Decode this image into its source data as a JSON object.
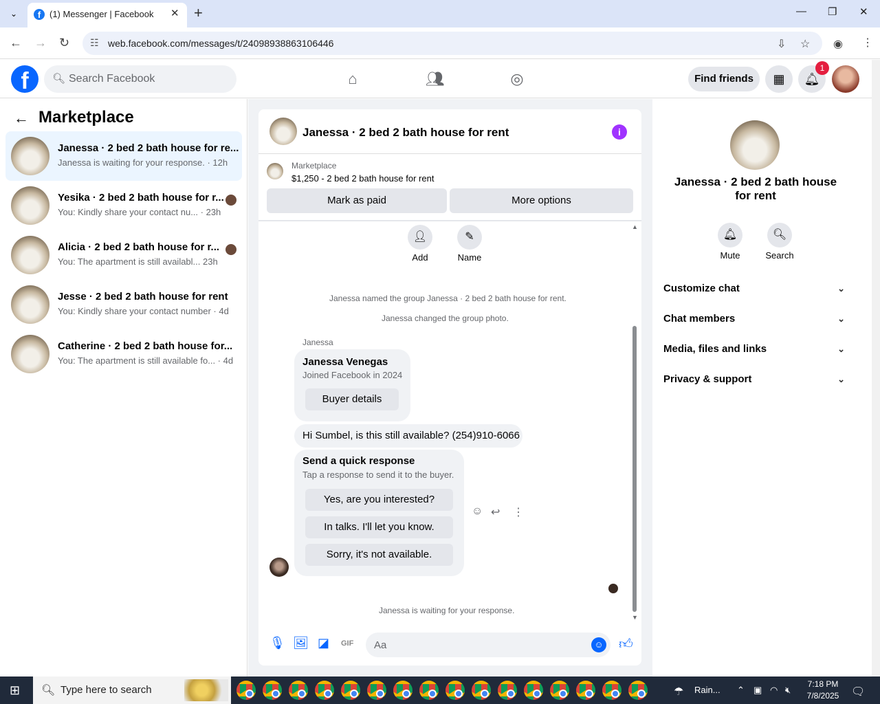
{
  "browser": {
    "tab_title": "(1) Messenger | Facebook",
    "favicon_letter": "f",
    "url": "web.facebook.com/messages/t/24098938863106446",
    "new_tab": "+",
    "minimize": "—",
    "restore": "❐",
    "close": "✕"
  },
  "fb_header": {
    "logo_letter": "f",
    "search_placeholder": "Search Facebook",
    "find_friends": "Find friends",
    "notification_count": "1"
  },
  "sidebar": {
    "title": "Marketplace",
    "conversations": [
      {
        "name": "Janessa · 2 bed 2 bath house for re...",
        "message": "Janessa is waiting for your response. · 12h"
      },
      {
        "name": "Yesika · 2 bed 2 bath house for r...",
        "message": "You: Kindly share your contact nu... · 23h"
      },
      {
        "name": "Alicia · 2 bed 2 bath house for r...",
        "message": "You: The apartment is still availabl... 23h"
      },
      {
        "name": "Jesse · 2 bed 2 bath house for rent",
        "message": "You: Kindly share your contact number · 4d"
      },
      {
        "name": "Catherine · 2 bed 2 bath house for...",
        "message": "You: The apartment is still available fo... · 4d"
      }
    ]
  },
  "chat": {
    "title": "Janessa · 2 bed 2 bath house for rent",
    "marketplace_label": "Marketplace",
    "listing": "$1,250 - 2 bed 2 bath house for rent",
    "mark_paid": "Mark as paid",
    "more_options": "More options",
    "add_label": "Add",
    "name_label": "Name",
    "system_1": "Janessa named the group Janessa · 2 bed 2 bath house for rent.",
    "system_2": "Janessa changed the group photo.",
    "sender": "Janessa",
    "card_name": "Janessa Venegas",
    "card_sub": "Joined Facebook in 2024",
    "buyer_details": "Buyer details",
    "message": "Hi Sumbel, is this still available? (254)910-6066",
    "quick_title": "Send a quick response",
    "quick_sub": "Tap a response to send it to the buyer.",
    "quick_responses": [
      "Yes, are you interested?",
      "In talks. I'll let you know.",
      "Sorry, it's not available."
    ],
    "waiting": "Janessa is waiting for your response.",
    "composer_placeholder": "Aa",
    "gif_label": "GIF"
  },
  "right_panel": {
    "title": "Janessa · 2 bed 2 bath house for rent",
    "mute": "Mute",
    "search": "Search",
    "sections": [
      "Customize chat",
      "Chat members",
      "Media, files and links",
      "Privacy & support"
    ]
  },
  "taskbar": {
    "search_placeholder": "Type here to search",
    "weather": "Rain...",
    "time": "7:18 PM",
    "date": "7/8/2025"
  },
  "colors": {
    "accent": "#0866ff",
    "info": "#a033ff",
    "badge": "#e41e3f"
  }
}
